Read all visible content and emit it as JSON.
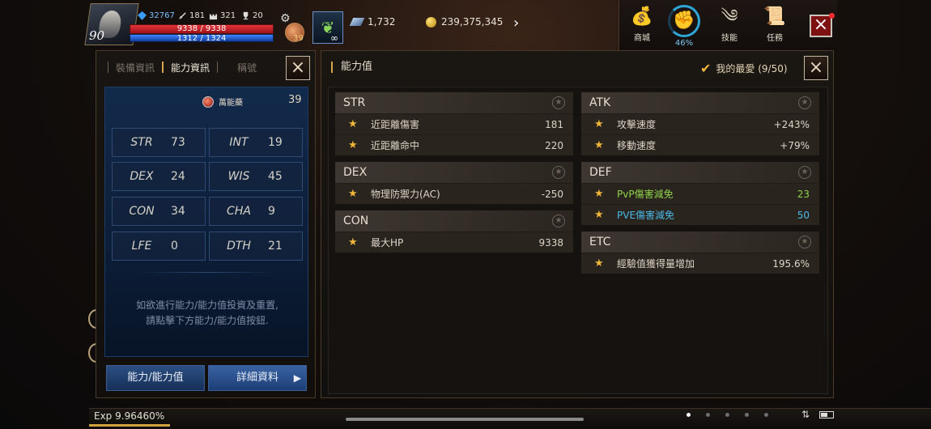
{
  "hud": {
    "level": "90",
    "stat_crystal": "32767",
    "stat_sword": "181",
    "stat_castle": "321",
    "stat_trophy": "20",
    "hp": "9338 / 9338",
    "mp": "1312 / 1324",
    "potion_count": "39",
    "infinity": "∞",
    "diamonds": "1,732",
    "gold": "239,375,345"
  },
  "topmenu": {
    "shop": "商城",
    "percent": "46%",
    "skills": "技能",
    "quests": "任務"
  },
  "left": {
    "tabs": [
      "裝備資訊",
      "能力資訊",
      "稱號"
    ],
    "bonus_label": "萬能藥",
    "bonus_value": "39",
    "stats": [
      {
        "k": "STR",
        "v": "73"
      },
      {
        "k": "INT",
        "v": "19"
      },
      {
        "k": "DEX",
        "v": "24"
      },
      {
        "k": "WIS",
        "v": "45"
      },
      {
        "k": "CON",
        "v": "34"
      },
      {
        "k": "CHA",
        "v": "9"
      },
      {
        "k": "LFE",
        "v": "0"
      },
      {
        "k": "DTH",
        "v": "21"
      }
    ],
    "hint_line1": "如欲進行能力/能力值投資及重置,",
    "hint_line2": "請點擊下方能力/能力值按鈕.",
    "btn_ability": "能力/能力值",
    "btn_detail": "詳細資料"
  },
  "right": {
    "title": "能力值",
    "favorites": "我的最愛 (9/50)",
    "groups": {
      "str": {
        "head": "STR",
        "rows": [
          {
            "label": "近距離傷害",
            "value": "181"
          },
          {
            "label": "近距離命中",
            "value": "220"
          }
        ]
      },
      "dex": {
        "head": "DEX",
        "rows": [
          {
            "label": "物理防禦力(AC)",
            "value": "-250"
          }
        ]
      },
      "con": {
        "head": "CON",
        "rows": [
          {
            "label": "最大HP",
            "value": "9338"
          }
        ]
      },
      "atk": {
        "head": "ATK",
        "rows": [
          {
            "label": "攻擊速度",
            "value": "+243%"
          },
          {
            "label": "移動速度",
            "value": "+79%"
          }
        ]
      },
      "def": {
        "head": "DEF",
        "rows": [
          {
            "label": "PvP傷害減免",
            "value": "23"
          },
          {
            "label": "PVE傷害減免",
            "value": "50"
          }
        ]
      },
      "etc": {
        "head": "ETC",
        "rows": [
          {
            "label": "經驗值獲得量增加",
            "value": "195.6%"
          }
        ]
      }
    }
  },
  "bottom": {
    "exp": "Exp 9.96460%"
  },
  "colors": {
    "accent_gold": "#d9a54b",
    "hp_red": "#e3343a",
    "mp_blue": "#3f86ff",
    "pvp_green": "#8fd24a",
    "pve_cyan": "#49b9e6"
  }
}
